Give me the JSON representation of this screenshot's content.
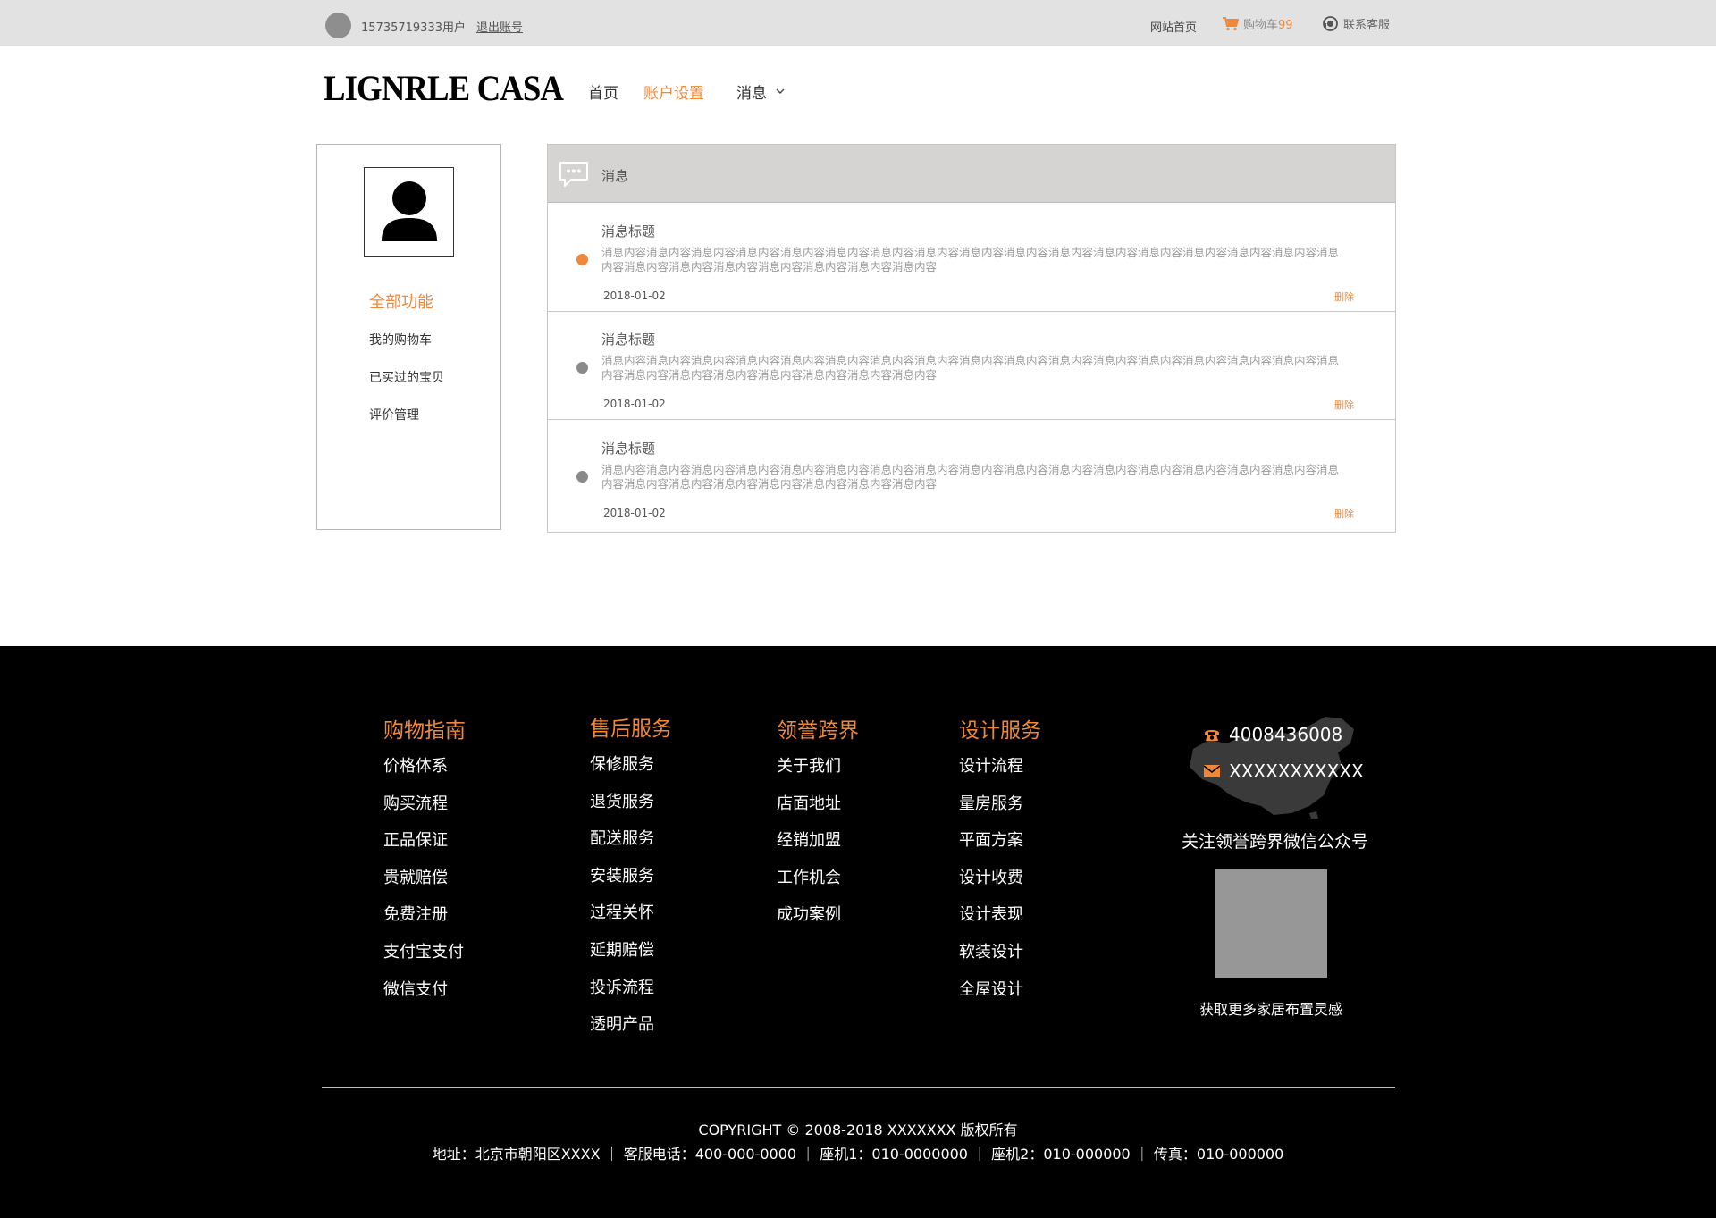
{
  "topbar": {
    "username": "15735719333用户",
    "logout": "退出账号",
    "home": "网站首页",
    "cart_label": "购物车",
    "cart_count": "99",
    "service": "联系客服"
  },
  "header": {
    "logo": "LIGNRLE CASA",
    "nav": {
      "home": "首页",
      "account": "账户设置",
      "messages": "消息"
    }
  },
  "sidebar": {
    "all_functions": "全部功能",
    "links": [
      "我的购物车",
      "已买过的宝贝",
      "评价管理"
    ]
  },
  "panel": {
    "title": "消息",
    "messages": [
      {
        "title": "消息标题",
        "body": "消息内容消息内容消息内容消息内容消息内容消息内容消息内容消息内容消息内容消息内容消息内容消息内容消息内容消息内容消息内容消息内容消息内容消息内容消息内容消息内容消息内容消息内容消息内容消息内容",
        "date": "2018-01-02",
        "delete": "删除",
        "unread": true
      },
      {
        "title": "消息标题",
        "body": "消息内容消息内容消息内容消息内容消息内容消息内容消息内容消息内容消息内容消息内容消息内容消息内容消息内容消息内容消息内容消息内容消息内容消息内容消息内容消息内容消息内容消息内容消息内容消息内容",
        "date": "2018-01-02",
        "delete": "删除",
        "unread": false
      },
      {
        "title": "消息标题",
        "body": "消息内容消息内容消息内容消息内容消息内容消息内容消息内容消息内容消息内容消息内容消息内容消息内容消息内容消息内容消息内容消息内容消息内容消息内容消息内容消息内容消息内容消息内容消息内容消息内容",
        "date": "2018-01-02",
        "delete": "删除",
        "unread": false
      }
    ]
  },
  "footer": {
    "columns": [
      {
        "heading": "购物指南",
        "links": [
          "价格体系",
          "购买流程",
          "正品保证",
          "贵就赔偿",
          "免费注册",
          "支付宝支付",
          "微信支付"
        ]
      },
      {
        "heading": "售后服务",
        "links": [
          "保修服务",
          "退货服务",
          "配送服务",
          "安装服务",
          "过程关怀",
          "延期赔偿",
          "投诉流程",
          "透明产品"
        ]
      },
      {
        "heading": "领誉跨界",
        "links": [
          "关于我们",
          "店面地址",
          "经销加盟",
          "工作机会",
          "成功案例"
        ]
      },
      {
        "heading": "设计服务",
        "links": [
          "设计流程",
          "量房服务",
          "平面方案",
          "设计收费",
          "设计表现",
          "软装设计",
          "全屋设计"
        ]
      }
    ],
    "phone": "4008436008",
    "email": "XXXXXXXXXXX",
    "follow": "关注领誉跨界微信公众号",
    "inspire": "获取更多家居布置灵感",
    "copyright": "COPYRIGHT  ©  2008-2018  XXXXXXX  版权所有",
    "address": "地址：北京市朝阳区XXXX ｜ 客服电话：400-000-0000  ｜ 座机1：010-0000000  ｜ 座机2：010-000000 ｜ 传真：010-000000"
  },
  "colors": {
    "accent": "#f0883c",
    "topbar_bg": "#e2e2e2",
    "panel_head_bg": "#d6d4d2",
    "footer_bg": "#000000",
    "qr_placeholder": "#979797"
  }
}
